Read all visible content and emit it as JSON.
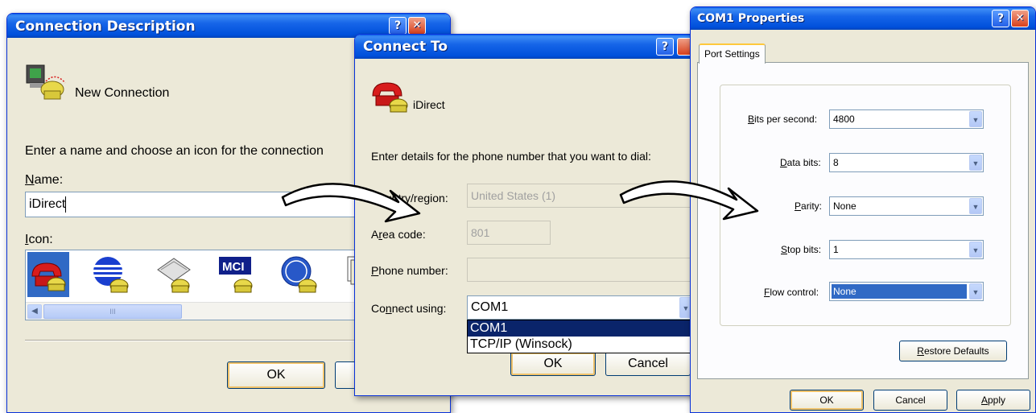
{
  "conn_dialog": {
    "title": "Connection Description",
    "app_name": "New Connection",
    "prompt": "Enter a name and choose an icon for the connection",
    "name_label_u": "N",
    "name_label_rest": "ame:",
    "name_value": "iDirect",
    "icon_label_u": "I",
    "icon_label_rest": "con:",
    "icons": [
      "red-phone-icon",
      "globe-phone-icon",
      "typewriter-phone-icon",
      "mci-phone-icon",
      "ge-phone-icon",
      "document-phone-icon"
    ],
    "scroll_grip": "III",
    "ok": "OK",
    "help_glyph": "?",
    "close_glyph": "✕"
  },
  "connect_to": {
    "title": "Connect To",
    "entry_name": "iDirect",
    "prompt": "Enter details for the phone number that you want to dial:",
    "country_label": "Country/region:",
    "country_value": "United States (1)",
    "area_label_pre": "A",
    "area_label_u": "r",
    "area_label_rest": "ea code:",
    "area_value": "801",
    "phone_label_u": "P",
    "phone_label_rest": "hone number:",
    "phone_value": "",
    "connect_label_pre": "Co",
    "connect_label_u": "n",
    "connect_label_rest": "nect using:",
    "connect_value": "COM1",
    "dropdown_options": [
      "COM1",
      "TCP/IP (Winsock)"
    ],
    "ok": "OK",
    "cancel": "Cancel",
    "help_glyph": "?"
  },
  "com_props": {
    "title": "COM1 Properties",
    "tab": "Port Settings",
    "bits_label_u": "B",
    "bits_label_rest": "its per second:",
    "bits_value": "4800",
    "data_label_u": "D",
    "data_label_rest": "ata bits:",
    "data_value": "8",
    "parity_label_u": "P",
    "parity_label_rest": "arity:",
    "parity_value": "None",
    "stop_label_u": "S",
    "stop_label_rest": "top bits:",
    "stop_value": "1",
    "flow_label_u": "F",
    "flow_label_rest": "low control:",
    "flow_value": "None",
    "restore_u": "R",
    "restore_rest": "estore Defaults",
    "ok": "OK",
    "cancel": "Cancel",
    "apply_u": "A",
    "apply_rest": "pply",
    "help_glyph": "?",
    "close_glyph": "✕"
  },
  "colors": {
    "title_blue": "#0050db",
    "face": "#ece9d8",
    "selection": "#0a246a"
  }
}
